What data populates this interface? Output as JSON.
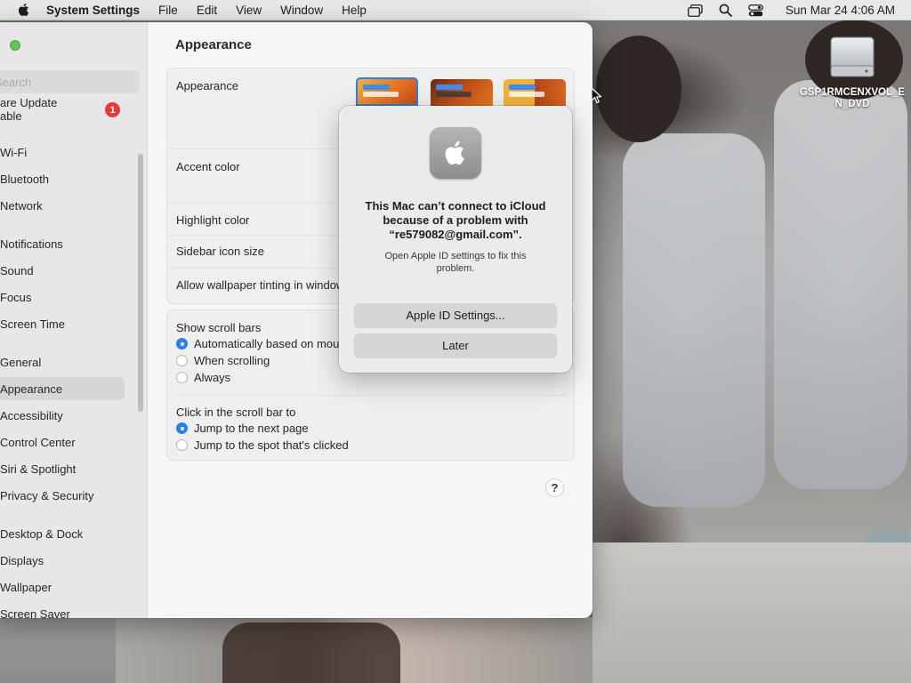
{
  "menubar": {
    "app_name": "System Settings",
    "menus": [
      "File",
      "Edit",
      "View",
      "Window",
      "Help"
    ],
    "clock": "Sun Mar 24  4:06 AM",
    "icons": [
      "apple-logo",
      "screen-mirroring-icon",
      "spotlight-search-icon",
      "control-center-icon"
    ]
  },
  "desktop": {
    "drive_label": "GSP1RMCENXVOL_EN_DVD"
  },
  "sidebar": {
    "search_placeholder": "Search",
    "software_update_label": "Software Update Available",
    "software_update_line1": "are Update",
    "software_update_line2": "able",
    "update_badge": "1",
    "items": [
      {
        "label": "Wi-Fi"
      },
      {
        "label": "Bluetooth"
      },
      {
        "label": "Network"
      },
      {
        "label": "Notifications"
      },
      {
        "label": "Sound"
      },
      {
        "label": "Focus"
      },
      {
        "label": "Screen Time"
      },
      {
        "label": "General"
      },
      {
        "label": "Appearance",
        "selected": true
      },
      {
        "label": "Accessibility"
      },
      {
        "label": "Control Center"
      },
      {
        "label": "Siri & Spotlight"
      },
      {
        "label": "Privacy & Security"
      },
      {
        "label": "Desktop & Dock"
      },
      {
        "label": "Displays"
      },
      {
        "label": "Wallpaper"
      },
      {
        "label": "Screen Saver"
      }
    ]
  },
  "main": {
    "title": "Appearance",
    "rows": {
      "appearance": "Appearance",
      "accent_color": "Accent color",
      "highlight_color": "Highlight color",
      "sidebar_icon_size": "Sidebar icon size",
      "wallpaper_tinting": "Allow wallpaper tinting in windows"
    },
    "scroll_bars": {
      "label": "Show scroll bars",
      "options": [
        "Automatically based on mouse or trackpad",
        "When scrolling",
        "Always"
      ],
      "selected_index": 0
    },
    "click_scroll_bar": {
      "label": "Click in the scroll bar to",
      "options": [
        "Jump to the next page",
        "Jump to the spot that's clicked"
      ],
      "selected_index": 0
    },
    "help_label": "?"
  },
  "dialog": {
    "heading": "This Mac can’t connect to iCloud because of a problem with “re579082@gmail.com”.",
    "body": "Open Apple ID settings to fix this problem.",
    "primary_button": "Apple ID Settings...",
    "secondary_button": "Later"
  },
  "colors": {
    "accent": "#2a7fe8",
    "badge": "#e8393a",
    "traffic_yellow": "#f4bf4f",
    "traffic_green": "#61c454"
  }
}
